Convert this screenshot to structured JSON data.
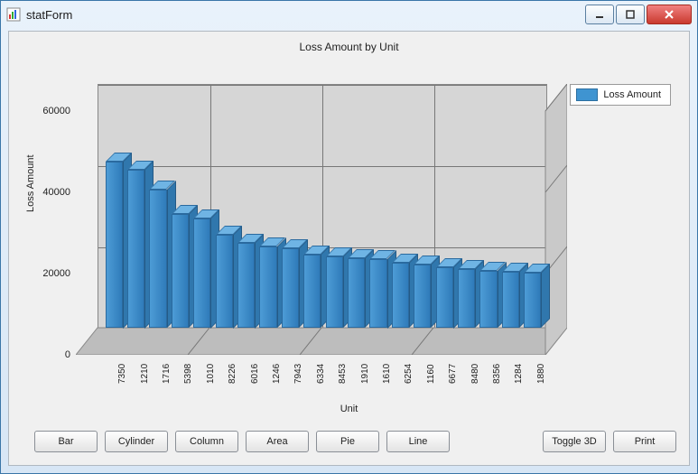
{
  "window": {
    "title": "statForm"
  },
  "chart": {
    "title": "Loss Amount by Unit",
    "xlabel": "Unit",
    "ylabel": "Loss Amount"
  },
  "legend": {
    "series1": "Loss Amount"
  },
  "buttons": {
    "bar": "Bar",
    "cylinder": "Cylinder",
    "column": "Column",
    "area": "Area",
    "pie": "Pie",
    "line": "Line",
    "toggle3d": "Toggle 3D",
    "print": "Print"
  },
  "yticks": [
    "0",
    "20000",
    "40000",
    "60000"
  ],
  "chart_data": {
    "type": "bar",
    "title": "Loss Amount by Unit",
    "xlabel": "Unit",
    "ylabel": "Loss Amount",
    "ylim": [
      0,
      60000
    ],
    "legend": [
      "Loss Amount"
    ],
    "categories": [
      "7350",
      "1210",
      "1716",
      "5398",
      "1010",
      "8226",
      "6016",
      "1246",
      "7943",
      "6334",
      "8453",
      "1910",
      "1610",
      "6254",
      "1160",
      "6677",
      "8480",
      "8356",
      "1284",
      "1880"
    ],
    "values": [
      41000,
      39000,
      34000,
      28000,
      27000,
      23000,
      21000,
      20000,
      19500,
      18000,
      17500,
      17200,
      17000,
      16000,
      15500,
      15000,
      14500,
      14000,
      13800,
      13500
    ]
  }
}
